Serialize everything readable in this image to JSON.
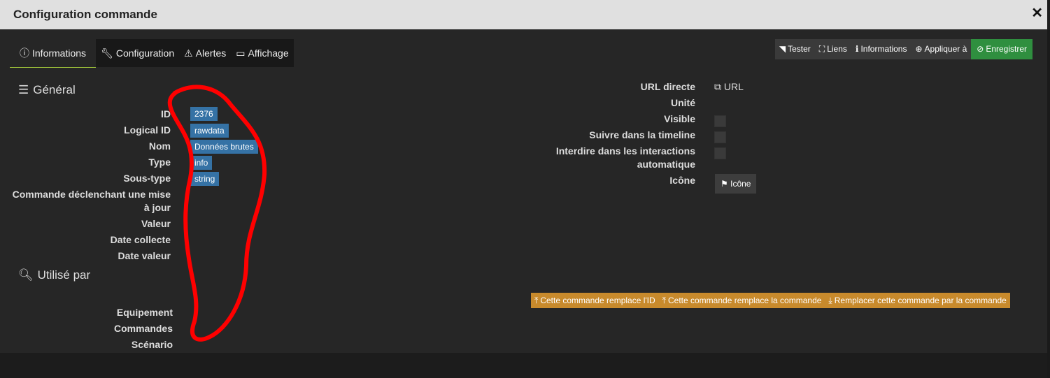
{
  "window": {
    "title": "Configuration commande",
    "close_glyph": "✕"
  },
  "tabs": [
    {
      "label": "Informations",
      "icon": "info-circle-icon"
    },
    {
      "label": "Configuration",
      "icon": "wrench-icon"
    },
    {
      "label": "Alertes",
      "icon": "warning-icon"
    },
    {
      "label": "Affichage",
      "icon": "monitor-icon"
    }
  ],
  "actions": [
    {
      "label": "Tester",
      "icon": "rss-icon"
    },
    {
      "label": "Liens",
      "icon": "link-frame-icon"
    },
    {
      "label": "Informations",
      "icon": "info-icon"
    },
    {
      "label": "Appliquer à",
      "icon": "plus-circle-icon"
    },
    {
      "label": "Enregistrer",
      "icon": "check-circle-icon",
      "color": "#2f8f3f"
    }
  ],
  "general": {
    "title": "Général",
    "fields": {
      "id_label": "ID",
      "id_value": "2376",
      "logical_label": "Logical ID",
      "logical_value": "rawdata",
      "nom_label": "Nom",
      "nom_value": "Données brutes",
      "type_label": "Type",
      "type_value": "info",
      "soustype_label": "Sous-type",
      "soustype_value": "string",
      "trigger_label_1": "Commande déclenchant une mise",
      "trigger_label_2": "à jour",
      "valeur_label": "Valeur",
      "date_collecte_label": "Date collecte",
      "date_valeur_label": "Date valeur"
    },
    "right": {
      "url_label": "URL directe",
      "url_link": "URL",
      "unite_label": "Unité",
      "visible_label": "Visible",
      "timeline_label": "Suivre dans la timeline",
      "interdire_label_1": "Interdire dans les interactions",
      "interdire_label_2": "automatique",
      "icone_label": "Icône",
      "icone_button": "Icône"
    }
  },
  "used_by": {
    "title": "Utilisé par",
    "equipement_label": "Equipement",
    "commandes_label": "Commandes",
    "scenario_label": "Scénario",
    "buttons": [
      "Cette commande remplace l'ID",
      "Cette commande remplace la commande",
      "Remplacer cette commande par la commande"
    ],
    "button_color": "#c88a2c"
  },
  "colors": {
    "badge": "#3572a5",
    "tab_active_underline": "#9fc43a",
    "annotation": "#ff0000"
  }
}
